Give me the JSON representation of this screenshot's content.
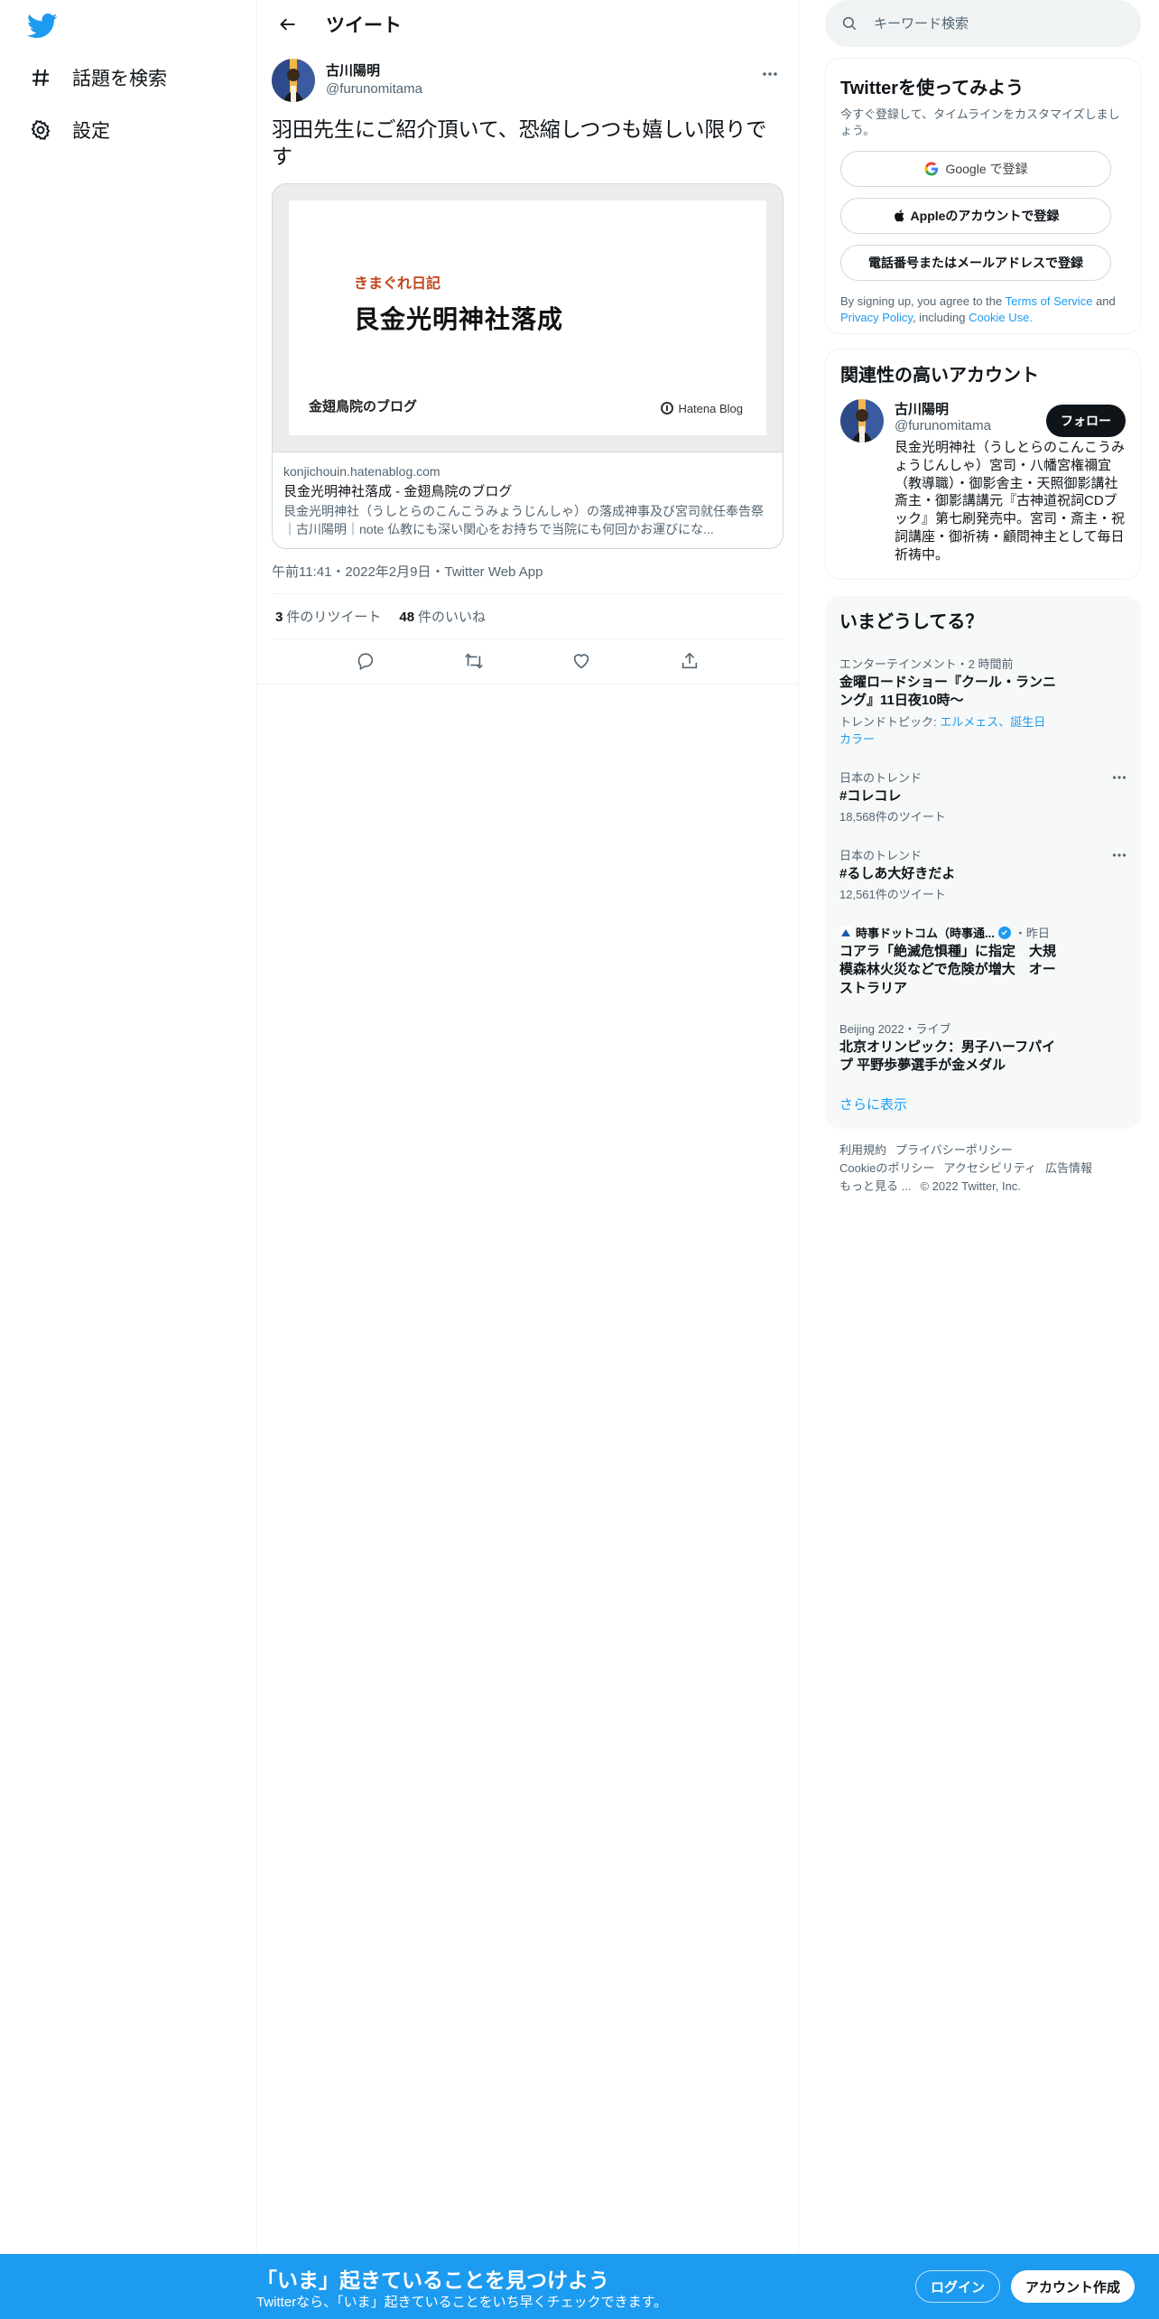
{
  "nav": {
    "items": [
      {
        "label": "話題を検索",
        "icon": "hashtag-icon"
      },
      {
        "label": "設定",
        "icon": "gear-icon"
      }
    ]
  },
  "header": {
    "title": "ツイート"
  },
  "tweet": {
    "author_name": "古川陽明",
    "author_handle": "@furunomitama",
    "text": "羽田先生にご紹介頂いて、恐縮しつつも嬉しい限りです",
    "card": {
      "image_category": "きまぐれ日記",
      "image_headline": "艮金光明神社落成",
      "image_blog_name": "金翅鳥院のブログ",
      "image_brand": "Hatena Blog",
      "domain": "konjichouin.hatenablog.com",
      "title": "艮金光明神社落成 - 金翅鳥院のブログ",
      "description": "艮金光明神社（うしとらのこんこうみょうじんしゃ）の落成神事及び宮司就任奉告祭｜古川陽明｜note 仏教にも深い関心をお持ちで当院にも何回かお運びにな..."
    },
    "timestamp": "午前11:41・2022年2月9日・Twitter Web App",
    "retweets_count": "3",
    "retweets_label": "件のリツイート",
    "likes_count": "48",
    "likes_label": "件のいいね"
  },
  "search": {
    "placeholder": "キーワード検索"
  },
  "signup": {
    "title": "Twitterを使ってみよう",
    "subtitle": "今すぐ登録して、タイムラインをカスタマイズしましょう。",
    "google_label": "Google で登録",
    "apple_label": "Appleのアカウントで登録",
    "phone_label": "電話番号またはメールアドレスで登録",
    "terms_prefix": "By signing up, you agree to the",
    "terms_link": "Terms of Service",
    "terms_and": "and",
    "privacy_link": "Privacy Policy",
    "including": ", including",
    "cookie_link": "Cookie Use."
  },
  "related": {
    "title": "関連性の高いアカウント",
    "name": "古川陽明",
    "handle": "@furunomitama",
    "follow_label": "フォロー",
    "bio": "艮金光明神社（うしとらのこんこうみょうじんしゃ）宮司・八幡宮権禰宜（教導職）・御影舎主・天照御影講社斎主・御影講講元『古神道祝詞CDブック』第七刷発売中。宮司・斎主・祝詞講座・御祈祷・顧問神主として毎日祈祷中。"
  },
  "trends": {
    "title": "いまどうしてる？",
    "items": [
      {
        "meta": "エンターテインメント・2 時間前",
        "name": "金曜ロードショー『クール・ランニング』11日夜10時〜",
        "sub_prefix": "トレンドトピック: ",
        "sub_links": "エルメェス、誕生日カラー"
      },
      {
        "meta": "日本のトレンド",
        "name": "#コレコレ",
        "count": "18,568件のツイート"
      },
      {
        "meta": "日本のトレンド",
        "name": "#るしあ大好きだよ",
        "count": "12,561件のツイート"
      },
      {
        "source": "時事ドットコム（時事通...",
        "time": "・昨日",
        "name": "コアラ「絶滅危惧種」に指定　大規模森林火災などで危険が増大　オーストラリア"
      },
      {
        "meta": "Beijing 2022・ライブ",
        "name": "北京オリンピック：男子ハーフパイプ 平野歩夢選手が金メダル"
      }
    ],
    "show_more": "さらに表示"
  },
  "footer": {
    "links": [
      "利用規約",
      "プライバシーポリシー",
      "Cookieのポリシー",
      "アクセシビリティ",
      "広告情報",
      "もっと見る ..."
    ],
    "copyright": "© 2022 Twitter, Inc."
  },
  "bottom_bar": {
    "title": "「いま」起きていることを見つけよう",
    "subtitle": "Twitterなら、「いま」起きていることをいち早くチェックできます。",
    "login_label": "ログイン",
    "signup_label": "アカウント作成"
  },
  "colors": {
    "accent": "#1d9bf0",
    "text": "#0f1419",
    "muted": "#536471",
    "card_category": "#c0461b"
  }
}
